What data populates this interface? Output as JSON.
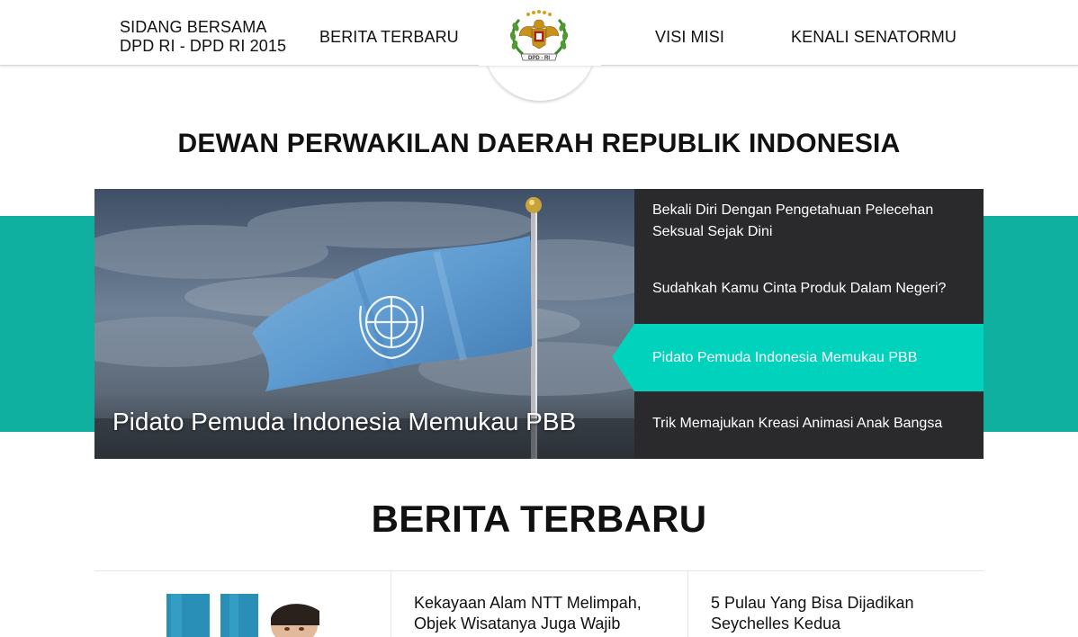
{
  "header": {
    "nav_left": [
      {
        "label": "SIDANG BERSAMA\nDPD RI - DPD RI 2015"
      },
      {
        "label": "BERITA TERBARU"
      }
    ],
    "nav_right": [
      {
        "label": "VISI MISI"
      },
      {
        "label": "KENALI SENATORMU"
      }
    ],
    "logo_icon": "garuda-emblem-icon",
    "logo_text": "DPD - RI"
  },
  "site_title": "DEWAN PERWAKILAN DAERAH REPUBLIK INDONESIA",
  "slider": {
    "caption": "Pidato Pemuda Indonesia Memukau PBB",
    "items": [
      {
        "title": "Bekali Diri Dengan Pengetahuan Pelecehan Seksual Sejak Dini"
      },
      {
        "title": "Sudahkah Kamu Cinta Produk Dalam Negeri?"
      },
      {
        "title": "Pidato Pemuda Indonesia Memukau PBB"
      },
      {
        "title": "Trik Memajukan Kreasi Animasi Anak Bangsa"
      }
    ],
    "active_index": 2
  },
  "latest": {
    "title": "BERITA TERBARU",
    "articles": [
      {
        "title": ""
      },
      {
        "title": "Kekayaan Alam NTT Melimpah, Objek Wisatanya Juga Wajib"
      },
      {
        "title": "5 Pulau Yang Bisa Dijadikan Seychelles Kedua"
      }
    ]
  },
  "colors": {
    "teal_band": "#10b0a0",
    "active_item": "#00d2bc",
    "slide_list_bg": "#2a2a2c"
  }
}
